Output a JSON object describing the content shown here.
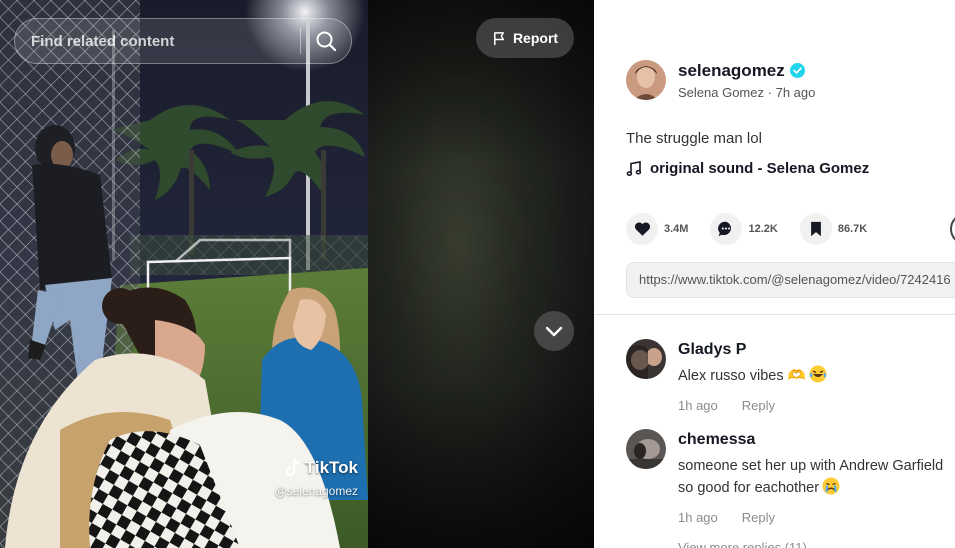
{
  "search": {
    "placeholder": "Find related content",
    "icon": "search-icon"
  },
  "report": {
    "label": "Report",
    "icon": "flag-icon"
  },
  "watermark": {
    "brand": "TikTok",
    "handle": "@selenagomez"
  },
  "post": {
    "username": "selenagomez",
    "display_name": "Selena Gomez",
    "time_ago": "7h ago",
    "separator": "·",
    "verified": true,
    "description": "The struggle man lol",
    "music": "original sound - Selena Gomez",
    "likes": "3.4M",
    "comments": "12.2K",
    "saves": "86.7K",
    "link": "https://www.tiktok.com/@selenagomez/video/7242416"
  },
  "comments": [
    {
      "name": "Gladys P",
      "text": "Alex russo vibes 🫶",
      "emoji": "😂",
      "time": "1h ago",
      "reply_label": "Reply"
    },
    {
      "name": "chemessa",
      "text_lines": [
        "someone set her up with Andrew Garfield",
        "so good for eachother"
      ],
      "emoji": "😭",
      "time": "1h ago",
      "reply_label": "Reply"
    }
  ],
  "view_more": "View more replies (11)",
  "colors": {
    "verified": "#20d5ec",
    "accent": "#fe2c55",
    "muted": "#8a8b91"
  }
}
